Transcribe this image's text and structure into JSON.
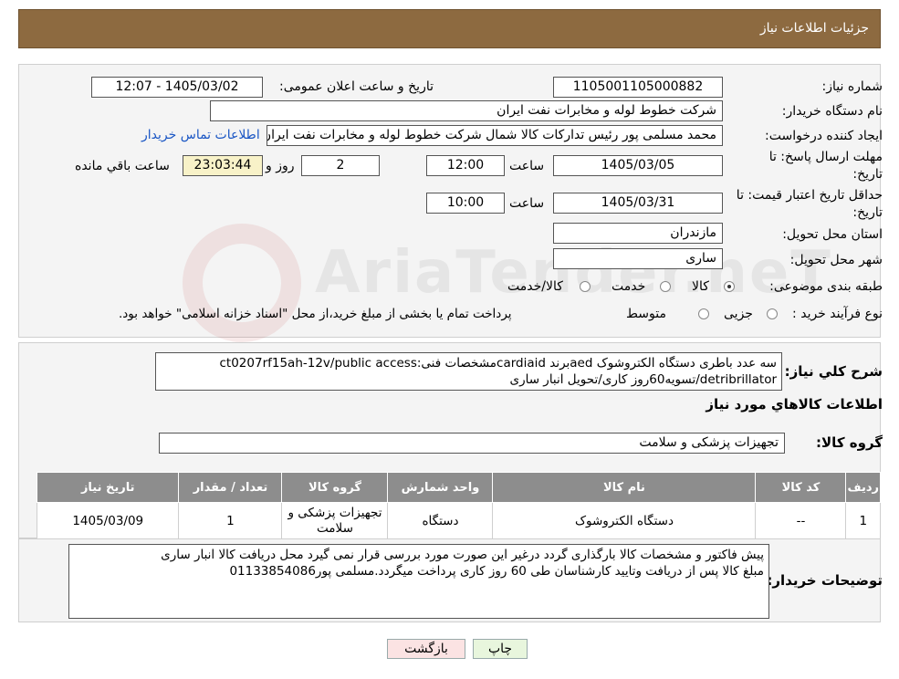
{
  "header": {
    "title": "جزئیات اطلاعات نیاز"
  },
  "need_info": {
    "need_number_label": "شماره نیاز:",
    "need_number": "1105001105000882",
    "announce_label": "تاریخ و ساعت اعلان عمومی:",
    "announce_value": "1405/03/02 - 12:07",
    "buyer_org_label": "نام دستگاه خریدار:",
    "buyer_org": "شرکت خطوط لوله و مخابرات نفت ایران",
    "requester_label": "ایجاد کننده درخواست:",
    "requester": "محمد مسلمی پور رئیس تدارکات کالا شمال شرکت خطوط لوله و مخابرات نفت ایران",
    "contact_link": "اطلاعات تماس خریدار",
    "deadline_label": "مهلت ارسال پاسخ: تا تاریخ:",
    "deadline_date": "1405/03/05",
    "time_label": "ساعت",
    "deadline_time": "12:00",
    "days_count": "2",
    "days_label": "روز و",
    "remaining_time": "23:03:44",
    "remaining_label": "ساعت باقي مانده",
    "validity_label": "حداقل تاریخ اعتبار قیمت: تا تاریخ:",
    "validity_date": "1405/03/31",
    "validity_time": "10:00",
    "province_label": "استان محل تحویل:",
    "province": "مازندران",
    "city_label": "شهر محل تحویل:",
    "city": "ساری",
    "category_label": "طبقه بندی موضوعی:",
    "category_options": [
      "کالا",
      "خدمت",
      "کالا/خدمت"
    ],
    "category_selected": "کالا",
    "process_label": "نوع فرآیند خرید :",
    "process_options": [
      "جزیی",
      "متوسط"
    ],
    "process_note": "پرداخت تمام یا بخشی از مبلغ خرید،از محل \"اسناد خزانه اسلامی\" خواهد بود."
  },
  "description": {
    "label": "شرح کلي نیاز:",
    "line1": "سه عدد باطری دستگاه الکتروشوک aedبرند cardiaidمشخصات فنی:ct0207rf15ah-12v/public access",
    "line2": "detribrillator/تسویه60روز کاری/تحویل انبار ساری"
  },
  "goods": {
    "section_title": "اطلاعات کالاهاي مورد نیاز",
    "group_label": "گروه کالا:",
    "group_value": "تجهیزات پزشکی و سلامت",
    "columns": [
      "ردیف",
      "کد کالا",
      "نام کالا",
      "واحد شمارش",
      "گروه کالا",
      "تعداد / مقدار",
      "تاریخ نیاز"
    ],
    "rows": [
      [
        "1",
        "--",
        "دستگاه الکتروشوک",
        "دستگاه",
        "تجهیزات پزشکی و سلامت",
        "1",
        "1405/03/09"
      ]
    ]
  },
  "buyer_notes": {
    "label": "توضیحات خریدار:",
    "line1": "پیش فاکتور و مشخصات کالا بارگذاری گردد درغیر این صورت مورد بررسی قرار نمی گیرد محل دریافت کالا انبار ساری",
    "line2": "مبلغ کالا پس از دریافت وتایید کارشناسان طی 60 روز کاری پرداخت میگردد.مسلمی پور01133854086"
  },
  "buttons": {
    "print": "چاپ",
    "back": "بازگشت"
  },
  "colors": {
    "header_bg": "#8d6a40",
    "table_header_bg": "#8d8d8d",
    "back_btn_bg": "#fbe3e3",
    "print_btn_bg": "#e8f6dd"
  }
}
